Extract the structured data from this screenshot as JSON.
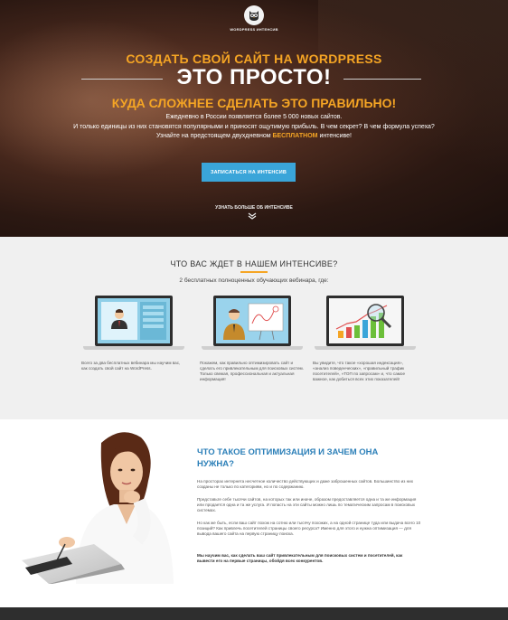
{
  "hero": {
    "logo_text": "WORDPRESS ИНТЕНСИВ",
    "title_top": "СОЗДАТЬ СВОЙ САЙТ НА WORDPRESS",
    "title_main": "ЭТО ПРОСТО!",
    "title_sub": "КУДА СЛОЖНЕЕ СДЕЛАТЬ ЭТО ПРАВИЛЬНО!",
    "para1": "Ежедневно в России появляется более 5 000 новых сайтов.",
    "para2_a": "И только единицы из них становятся популярными и приносят ощутимую прибыль. В чем секрет? В чем формула успеха? Узнайте на предстоящем двухдневном ",
    "para2_hl": "БЕСПЛАТНОМ",
    "para2_b": " интенсиве!",
    "cta_label": "ЗАПИСАТЬСЯ НА ИНТЕНСИВ",
    "more_label": "УЗНАТЬ БОЛЬШЕ ОБ ИНТЕНСИВЕ"
  },
  "section2": {
    "title": "ЧТО ВАС ЖДЕТ В НАШЕМ ИНТЕНСИВЕ?",
    "subtitle": "2 бесплатных полноценных обучающих вебинара, где:",
    "cards": [
      {
        "icon": "laptop-presenter-icon",
        "text": "Всего за два бесплатных вебинара мы научим вас, как создать свой сайт на WordPress."
      },
      {
        "icon": "laptop-whiteboard-icon",
        "text": "Покажем, как правильно оптимизировать сайт и сделать его привлекательным для поисковых систем. Только свежая, профессиональная и актуальная информация!"
      },
      {
        "icon": "laptop-growth-chart-icon",
        "text": "Вы увидите, что такое «хорошая индексация», «анализ поведенческих», «правильный трафик посетителей», «ТОП по запросам» и, что самое важное, как добиться всех этих показателей!"
      }
    ]
  },
  "section3": {
    "title": "ЧТО ТАКОЕ ОПТИМИЗАЦИЯ И ЗАЧЕМ ОНА НУЖНА?",
    "p1": "На просторах интернета несчетное количество действующих и даже заброшенных сайтов. Большинство из них созданы не только по категориям, но и по содержанию.",
    "p2": "Представьте себе тысячи сайтов, на которых так или иначе, образом предоставляется одна и та же информация или продается одна и та же услуга. И попасть на эти сайты можно лишь по тематическим запросам в поисковых системах.",
    "p3": "Но как же быть, если ваш сайт похож на сотню или тысячу похожих, а на одной странице туда или выдача всего 10 позиций? Как привлечь посетителей страницы своего ресурса? Именно для этого и нужна оптимизация — для вывода вашего сайта на первую страницу поиска.",
    "p4": "Мы научим вас, как сделать ваш сайт привлекательным для поисковых систем и посетителей, как вывести его на первые страницы, обойдя всех конкурентов."
  },
  "colors": {
    "accent_orange": "#f5a524",
    "cta_blue": "#3aa5d9",
    "heading_blue": "#2b7fb8"
  }
}
